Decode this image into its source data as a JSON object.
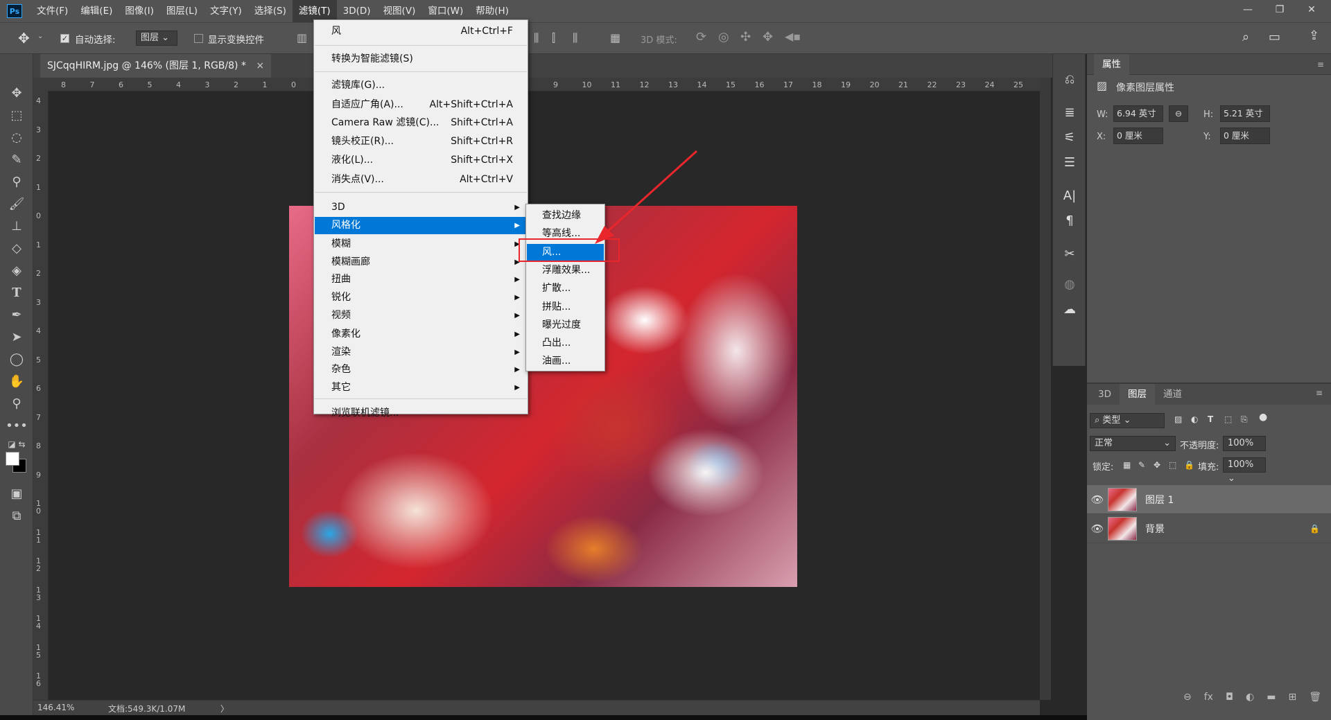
{
  "app": {
    "logo": "Ps"
  },
  "menubar": {
    "items": [
      "文件(F)",
      "编辑(E)",
      "图像(I)",
      "图层(L)",
      "文字(Y)",
      "选择(S)",
      "滤镜(T)",
      "3D(D)",
      "视图(V)",
      "窗口(W)",
      "帮助(H)"
    ],
    "active_index": 6
  },
  "window_controls": {
    "minimize": "—",
    "restore": "❐",
    "close": "✕"
  },
  "options": {
    "auto_select_label": "自动选择:",
    "auto_select_checked": true,
    "auto_select_target": "图层",
    "show_transform_label": "显示变换控件",
    "show_transform_checked": false,
    "mode3d_label": "3D 模式:"
  },
  "document": {
    "tab_title": "SJCqqHIRM.jpg @ 146% (图层 1, RGB/8) *",
    "tab_close": "×"
  },
  "ruler": {
    "h_ticks": [
      "8",
      "7",
      "6",
      "5",
      "4",
      "3",
      "2",
      "1",
      "0",
      "9",
      "10",
      "11",
      "12",
      "13",
      "14",
      "15",
      "16",
      "17",
      "18",
      "19",
      "20",
      "21",
      "22",
      "23",
      "24",
      "25"
    ],
    "v_ticks": [
      "4",
      "3",
      "2",
      "1",
      "0",
      "1",
      "2",
      "3",
      "4",
      "5",
      "6",
      "7",
      "8",
      "9",
      "1 0",
      "1 1",
      "1 2",
      "1 3",
      "1 4",
      "1 5",
      "1 6"
    ]
  },
  "status": {
    "zoom": "146.41%",
    "doc_info": "文档:549.3K/1.07M",
    "arrow": "〉"
  },
  "filter_menu": {
    "items": [
      {
        "label": "风",
        "shortcut": "Alt+Ctrl+F"
      },
      {
        "label": "转换为智能滤镜(S)",
        "shortcut": ""
      },
      {
        "label": "滤镜库(G)...",
        "shortcut": ""
      },
      {
        "label": "自适应广角(A)...",
        "shortcut": "Alt+Shift+Ctrl+A"
      },
      {
        "label": "Camera Raw 滤镜(C)...",
        "shortcut": "Shift+Ctrl+A"
      },
      {
        "label": "镜头校正(R)...",
        "shortcut": "Shift+Ctrl+R"
      },
      {
        "label": "液化(L)...",
        "shortcut": "Shift+Ctrl+X"
      },
      {
        "label": "消失点(V)...",
        "shortcut": "Alt+Ctrl+V"
      },
      {
        "label": "3D",
        "submenu": true
      },
      {
        "label": "风格化",
        "submenu": true,
        "highlighted": true
      },
      {
        "label": "模糊",
        "submenu": true
      },
      {
        "label": "模糊画廊",
        "submenu": true
      },
      {
        "label": "扭曲",
        "submenu": true
      },
      {
        "label": "锐化",
        "submenu": true
      },
      {
        "label": "视频",
        "submenu": true
      },
      {
        "label": "像素化",
        "submenu": true
      },
      {
        "label": "渲染",
        "submenu": true
      },
      {
        "label": "杂色",
        "submenu": true
      },
      {
        "label": "其它",
        "submenu": true
      },
      {
        "label": "浏览联机滤镜...",
        "shortcut": ""
      }
    ]
  },
  "stylize_submenu": {
    "items": [
      "查找边缘",
      "等高线...",
      "风...",
      "浮雕效果...",
      "扩散...",
      "拼贴...",
      "曝光过度",
      "凸出...",
      "油画..."
    ],
    "highlighted_index": 2
  },
  "properties": {
    "tab": "属性",
    "section": "像素图层属性",
    "w_label": "W:",
    "w_value": "6.94 英寸",
    "h_label": "H:",
    "h_value": "5.21 英寸",
    "x_label": "X:",
    "x_value": "0 厘米",
    "y_label": "Y:",
    "y_value": "0 厘米"
  },
  "layers_panel": {
    "tabs": [
      "3D",
      "图层",
      "通道"
    ],
    "active_tab": 1,
    "filter_label": "类型",
    "blend_mode": "正常",
    "opacity_label": "不透明度:",
    "opacity_value": "100%",
    "lock_label": "锁定:",
    "fill_label": "填充:",
    "fill_value": "100%",
    "layers": [
      {
        "name": "图层 1",
        "selected": true,
        "locked": false
      },
      {
        "name": "背景",
        "selected": false,
        "locked": true
      }
    ]
  },
  "colors": {
    "highlight": "#0078d7",
    "annotation": "#e8262b"
  }
}
